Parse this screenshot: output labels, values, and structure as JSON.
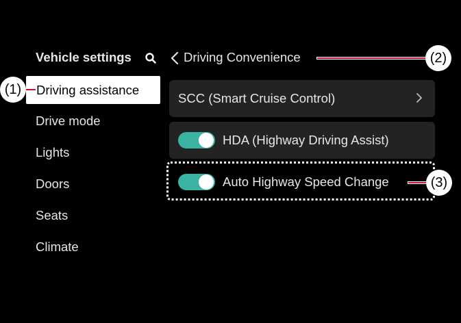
{
  "sidebar": {
    "title": "Vehicle settings",
    "items": [
      {
        "label": "Driving assistance",
        "selected": true
      },
      {
        "label": "Drive mode"
      },
      {
        "label": "Lights"
      },
      {
        "label": "Doors"
      },
      {
        "label": "Seats"
      },
      {
        "label": "Climate"
      }
    ]
  },
  "header": {
    "title": "Driving Convenience"
  },
  "settings": [
    {
      "label": "SCC (Smart Cruise Control)",
      "type": "submenu"
    },
    {
      "label": "HDA (Highway Driving Assist)",
      "type": "toggle",
      "on": true
    },
    {
      "label": "Auto Highway Speed Change",
      "type": "toggle",
      "on": true
    }
  ],
  "callouts": [
    "(1)",
    "(2)",
    "(3)"
  ],
  "colors": {
    "toggle_on": "#3ab3a3",
    "card_bg": "#232323",
    "leader": "#c8102e"
  }
}
